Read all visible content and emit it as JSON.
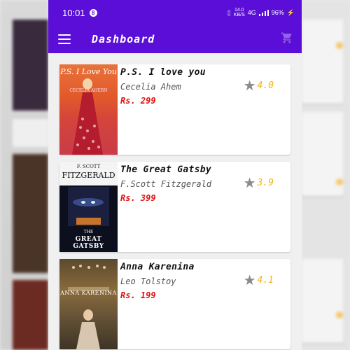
{
  "status_bar": {
    "time": "10:01",
    "notification_badge": "8",
    "speed_value": "14.0",
    "speed_unit": "KB/S",
    "network": "4G",
    "battery": "96%"
  },
  "app_bar": {
    "title": "Dashboard",
    "menu_icon": "hamburger-menu-icon",
    "cart_icon": "cart-icon"
  },
  "books": [
    {
      "title": "P.S. I love you",
      "author": "Cecelia Ahem",
      "price": "Rs. 299",
      "rating": "4.0",
      "cover_title": "P.S. I Love You",
      "cover_author": "CECELIA AHERN"
    },
    {
      "title": "The Great Gatsby",
      "author": "F.Scott Fitzgerald",
      "price": "Rs. 399",
      "rating": "3.9",
      "cover_top": "F. SCOTT",
      "cover_name": "FITZGERALD",
      "cover_small": "THE",
      "cover_title": "GREAT GATSBY"
    },
    {
      "title": "Anna Karenina",
      "author": "Leo Tolstoy",
      "price": "Rs. 199",
      "rating": "4.1",
      "cover_title": "ANNA KARENINA"
    }
  ],
  "colors": {
    "primary": "#5a0ed8",
    "price": "#e01010",
    "rating": "#f2b50f",
    "star": "#8a8a8a"
  }
}
